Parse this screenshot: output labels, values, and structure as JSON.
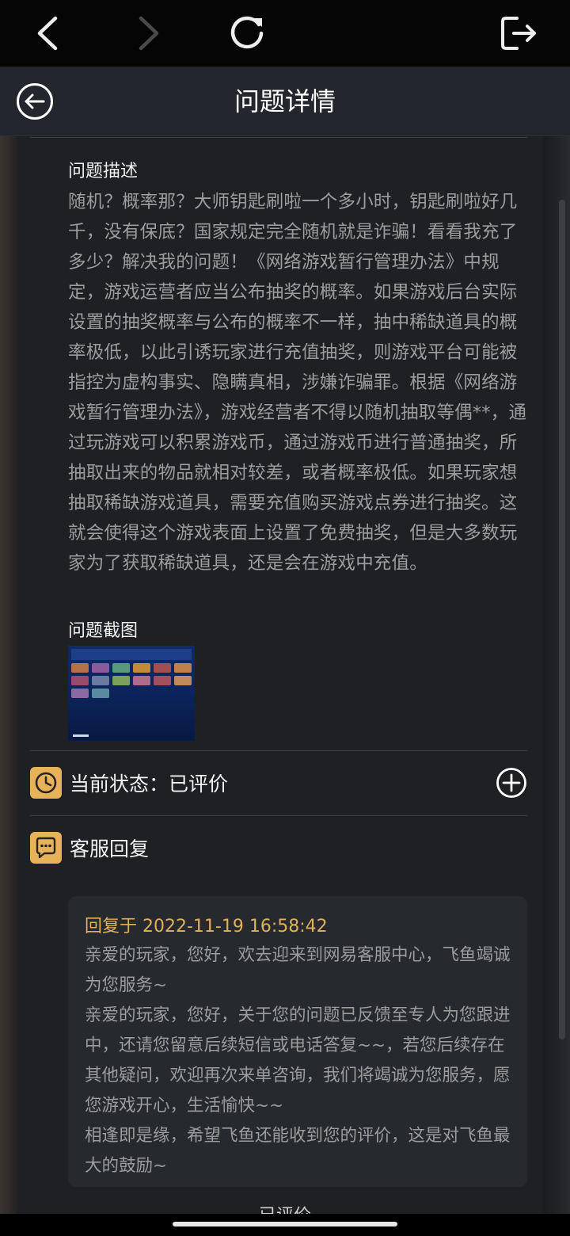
{
  "toolbar": {
    "back_icon": "chevron-left-icon",
    "forward_icon": "chevron-right-icon",
    "reload_icon": "reload-icon",
    "exit_icon": "exit-icon"
  },
  "header": {
    "title": "问题详情",
    "back_icon": "circle-arrow-left-icon"
  },
  "description": {
    "label": "问题描述",
    "text": "随机？概率那？大师钥匙刷啦一个多小时，钥匙刷啦好几千，没有保底？国家规定完全随机就是诈骗！看看我充了多少？解决我的问题！《网络游戏暂行管理办法》中规定，游戏运营者应当公布抽奖的概率。如果游戏后台实际设置的抽奖概率与公布的概率不一样，抽中稀缺道具的概率极低，以此引诱玩家进行充值抽奖，则游戏平台可能被指控为虚构事实、隐瞒真相，涉嫌诈骗罪。根据《网络游戏暂行管理办法》，游戏经营者不得以随机抽取等偶**，通过玩游戏可以积累游戏币，通过游戏币进行普通抽奖，所抽取出来的物品就相对较差，或者概率极低。如果玩家想抽取稀缺游戏道具，需要充值购买游戏点券进行抽奖。这就会使得这个游戏表面上设置了免费抽奖，但是大多数玩家为了获取稀缺道具，还是会在游戏中充值。"
  },
  "screenshot": {
    "label": "问题截图"
  },
  "status": {
    "text": "当前状态：已评价",
    "icon": "clock-icon",
    "action_icon": "plus-circle-icon"
  },
  "reply": {
    "label": "客服回复",
    "icon": "chat-bubble-icon",
    "time": "回复于 2022-11-19 16:58:42",
    "text": "亲爱的玩家，您好，欢去迎来到网易客服中心，飞鱼竭诚为您服务~\n亲爱的玩家，您好，关于您的问题已反馈至专人为您跟进中，还请您留意后续短信或电话答复~~，若您后续存在其他疑问，欢迎再次来单咨询，我们将竭诚为您服务，愿您游戏开心，生活愉快~~\n相逢即是缘，希望飞鱼还能收到您的评价，这是对飞鱼最大的鼓励~"
  },
  "next_section_label": "已评价",
  "colors": {
    "accent": "#e6b35a",
    "reply_time": "#e0b05b",
    "panel": "#1e2024"
  }
}
